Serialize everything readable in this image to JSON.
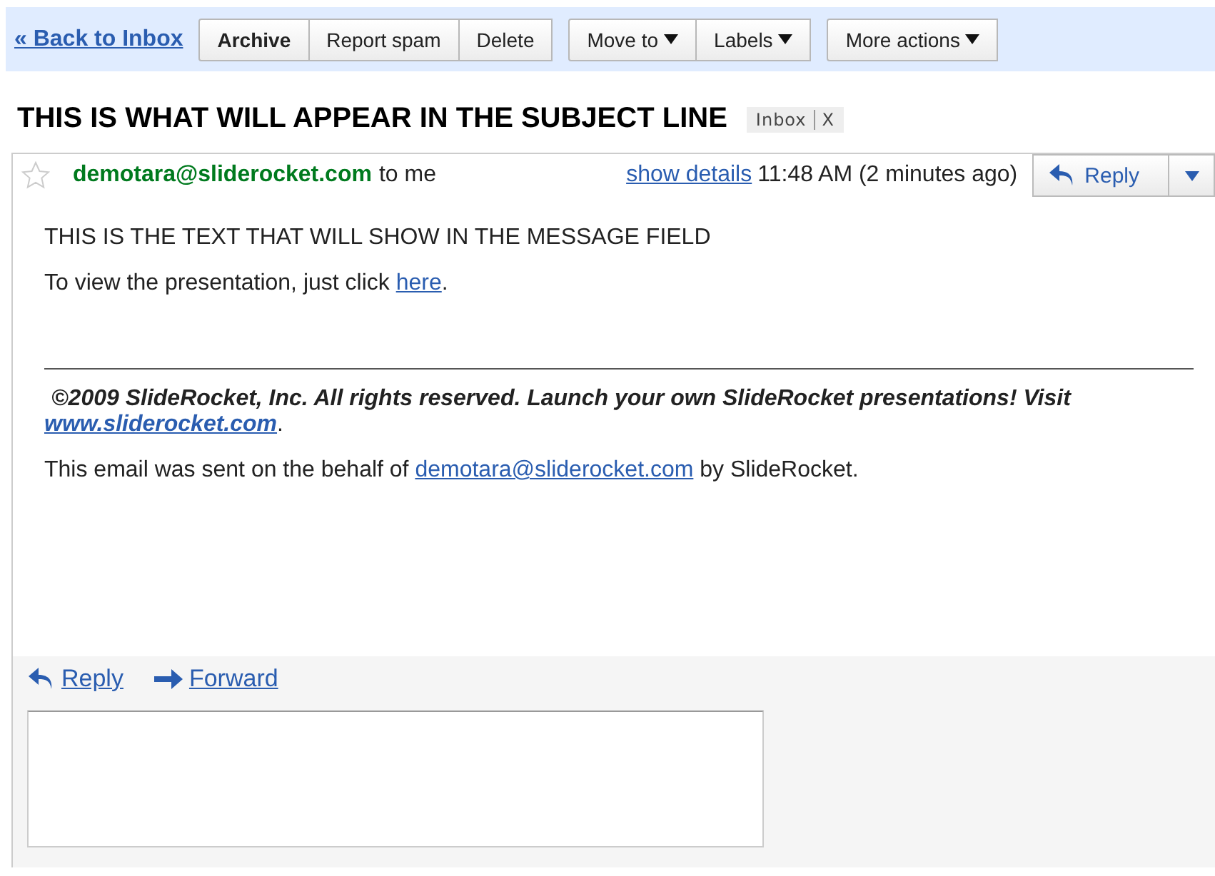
{
  "back_link": "« Back to Inbox",
  "toolbar": [
    {
      "buttons": [
        {
          "label": "Archive",
          "bold": true,
          "menu": false
        },
        {
          "label": "Report spam",
          "bold": false,
          "menu": false
        },
        {
          "label": "Delete",
          "bold": false,
          "menu": false
        }
      ]
    },
    {
      "buttons": [
        {
          "label": "Move to",
          "bold": false,
          "menu": true
        },
        {
          "label": "Labels",
          "bold": false,
          "menu": true
        }
      ]
    },
    {
      "buttons": [
        {
          "label": "More actions",
          "bold": false,
          "menu": true
        }
      ]
    }
  ],
  "subject": "THIS IS WHAT WILL APPEAR IN THE SUBJECT LINE",
  "label_tag": {
    "label": "Inbox",
    "remove": "X"
  },
  "message": {
    "starred": false,
    "sender": "demotara@sliderocket.com",
    "recipient": "to me",
    "details_link": "show details",
    "time": "11:48 AM (2 minutes ago)",
    "reply_button": "Reply",
    "body": "THIS IS THE TEXT THAT WILL SHOW IN THE MESSAGE FIELD",
    "view_text": "To view the presentation, just click ",
    "view_link": "here",
    "view_end": ".",
    "footer_text": "©2009 SlideRocket, Inc. All rights reserved. Launch your own SlideRocket presentations! Visit ",
    "footer_link": "www.sliderocket.com",
    "footer_end": ".",
    "sent_text": "This email was sent on the behalf of ",
    "sent_link": "demotara@sliderocket.com",
    "sent_end": " by SlideRocket."
  },
  "actions": {
    "reply": "Reply",
    "forward": "Forward"
  }
}
